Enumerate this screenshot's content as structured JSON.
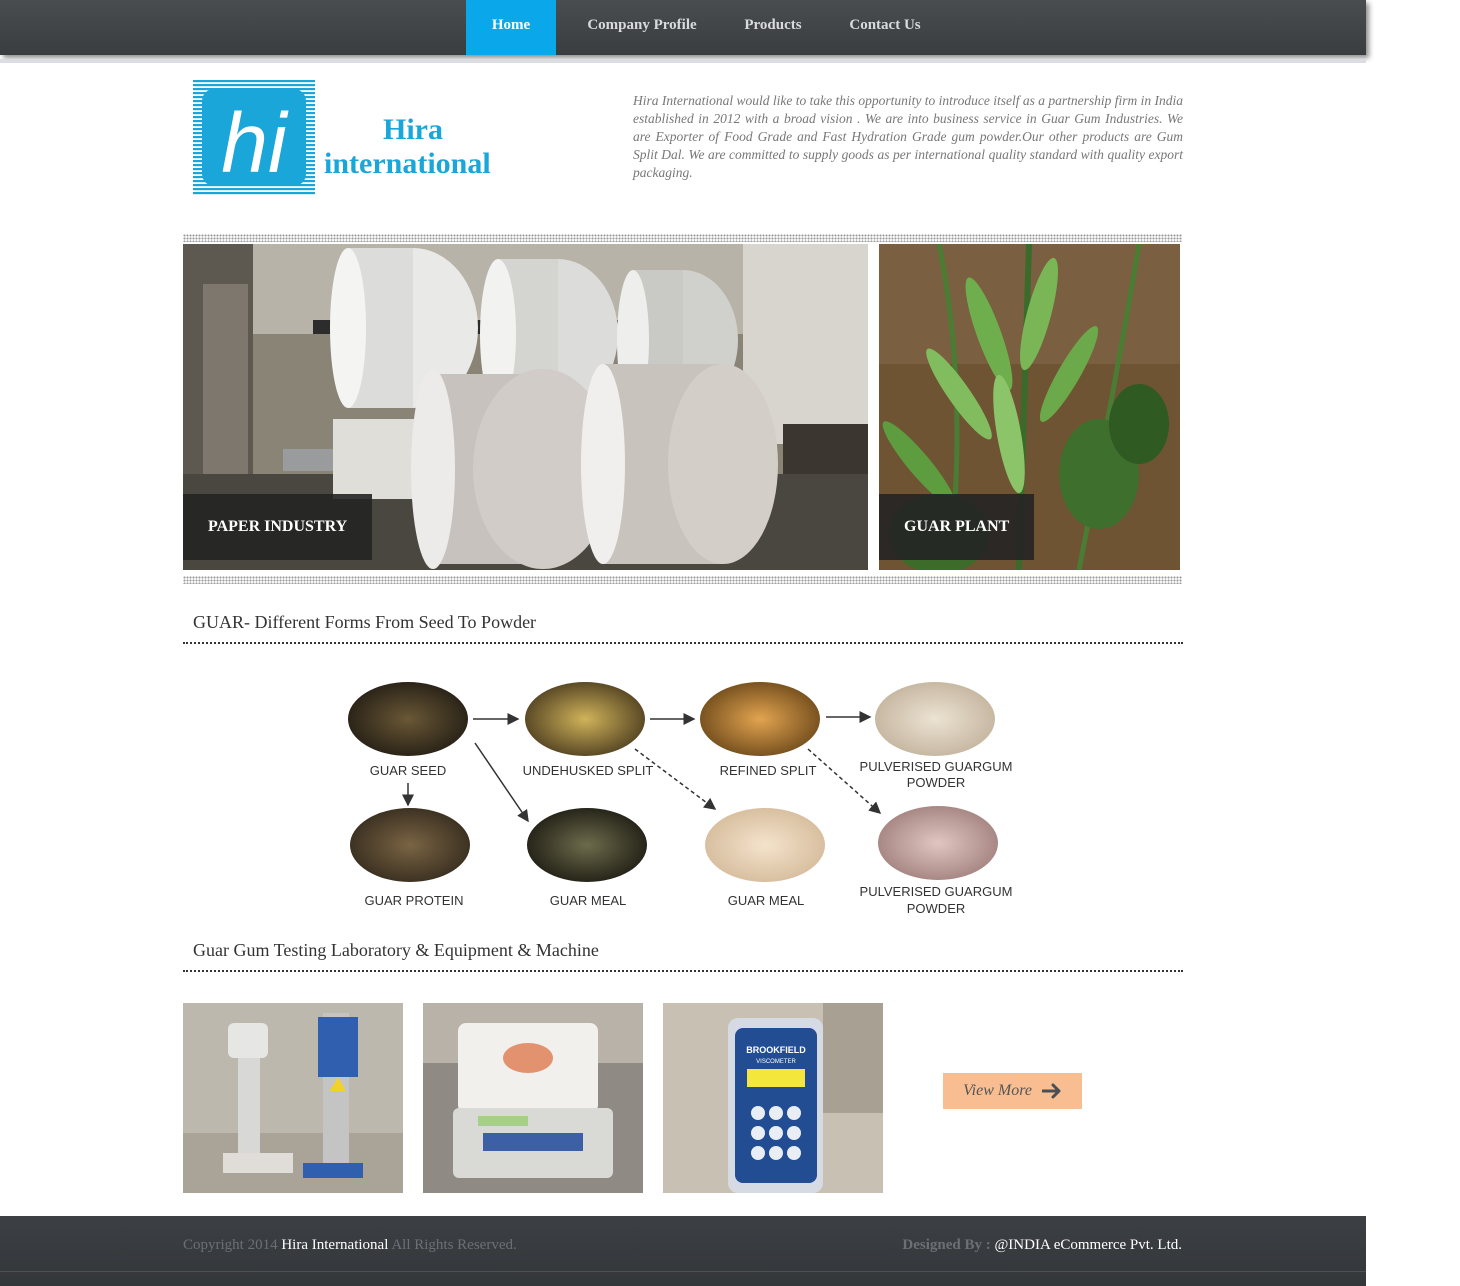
{
  "nav": {
    "items": [
      {
        "label": "Home",
        "active": true
      },
      {
        "label": "Company Profile"
      },
      {
        "label": "Products"
      },
      {
        "label": "Contact Us"
      }
    ]
  },
  "logo": {
    "mark": "hi",
    "line1": "Hira",
    "line2": "international"
  },
  "intro": "Hira International would like to take this opportunity to introduce itself as a partnership firm in India established in 2012 with a broad vision . We are into business service in Guar Gum Industries. We are Exporter of Food Grade and Fast Hydration Grade gum powder.Our other products are Gum Split Dal. We are committed to supply goods as per international quality standard with quality export packaging.",
  "banners": [
    {
      "label": "PAPER INDUSTRY"
    },
    {
      "label": "GUAR PLANT"
    }
  ],
  "section_guar": {
    "title": "GUAR- Different Forms From Seed To Powder",
    "diagram": {
      "guar_seed": "GUAR SEED",
      "undehusked_split": "UNDEHUSKED SPLIT",
      "refined_split": "REFINED SPLIT",
      "pulverised_1_l1": "PULVERISED GUARGUM",
      "pulverised_1_l2": "POWDER",
      "guar_protein": "GUAR PROTEIN",
      "guar_meal_1": "GUAR MEAL",
      "guar_meal_2": "GUAR MEAL",
      "pulverised_2_l1": "PULVERISED GUARGUM",
      "pulverised_2_l2": "POWDER"
    }
  },
  "section_lab": {
    "title": "Guar Gum Testing Laboratory & Equipment & Machine",
    "view_more": "View More",
    "viscometer_brand": "BROOKFIELD",
    "viscometer_sub": "VISCOMETER"
  },
  "footer": {
    "copyright_prefix": "Copyright 2014",
    "copyright_brand": "Hira International",
    "copyright_suffix": "All Rights Reserved.",
    "designed_by_label": "Designed By :",
    "designed_by_company": "@INDIA eCommerce Pvt. Ltd."
  },
  "colors": {
    "nav_active": "#0aa8ea",
    "nav_bg": "#3f4246",
    "view_more_bg": "#f8be92",
    "logo_blue": "#1aa6d9"
  }
}
